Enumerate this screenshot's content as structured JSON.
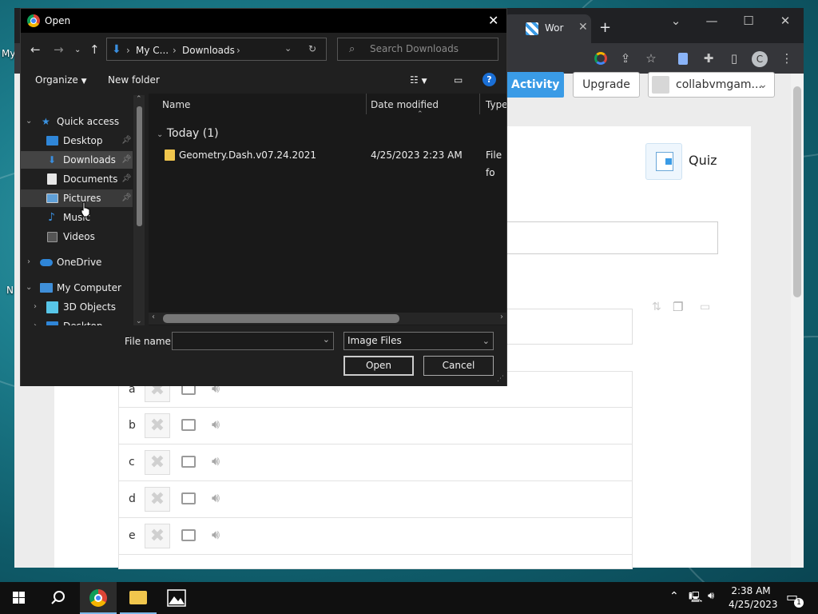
{
  "desktop": {
    "icon_labels": [
      "My",
      "N"
    ]
  },
  "chrome": {
    "tabs": [
      {
        "label": "Wor"
      }
    ],
    "new_tab_symbol": "+",
    "profile_initial": "C"
  },
  "page": {
    "activity_button": "Activity",
    "upgrade_button": "Upgrade",
    "account_name": "collabvmgam...",
    "quiz_label": "Quiz",
    "answers": [
      {
        "letter": "a"
      },
      {
        "letter": "b"
      },
      {
        "letter": "c"
      },
      {
        "letter": "d"
      },
      {
        "letter": "e"
      }
    ]
  },
  "dialog": {
    "title": "Open",
    "breadcrumb": [
      "My C...",
      "Downloads"
    ],
    "search_placeholder": "Search Downloads",
    "organize_label": "Organize",
    "new_folder_label": "New folder",
    "nav_items": [
      {
        "label": "Quick access",
        "icon": "star-icon"
      },
      {
        "label": "Desktop",
        "icon": "desktop-icon"
      },
      {
        "label": "Downloads",
        "icon": "download-icon"
      },
      {
        "label": "Documents",
        "icon": "documents-icon"
      },
      {
        "label": "Pictures",
        "icon": "pictures-icon"
      },
      {
        "label": "Music",
        "icon": "music-icon"
      },
      {
        "label": "Videos",
        "icon": "videos-icon"
      },
      {
        "label": "OneDrive",
        "icon": "cloud-icon"
      },
      {
        "label": "My Computer",
        "icon": "computer-icon"
      },
      {
        "label": "3D Objects",
        "icon": "cube-icon"
      },
      {
        "label": "Desktop",
        "icon": "desktop-icon"
      }
    ],
    "columns": {
      "name": "Name",
      "date_modified": "Date modified",
      "type": "Type"
    },
    "group_heading": "Today (1)",
    "files": [
      {
        "name": "Geometry.Dash.v07.24.2021",
        "date": "4/25/2023 2:23 AM",
        "type": "File fo"
      }
    ],
    "file_name_label": "File name:",
    "file_name_value": "",
    "file_type": "Image Files",
    "open_button": "Open",
    "cancel_button": "Cancel"
  },
  "taskbar": {
    "time": "2:38 AM",
    "date": "4/25/2023",
    "notification_count": "1"
  }
}
